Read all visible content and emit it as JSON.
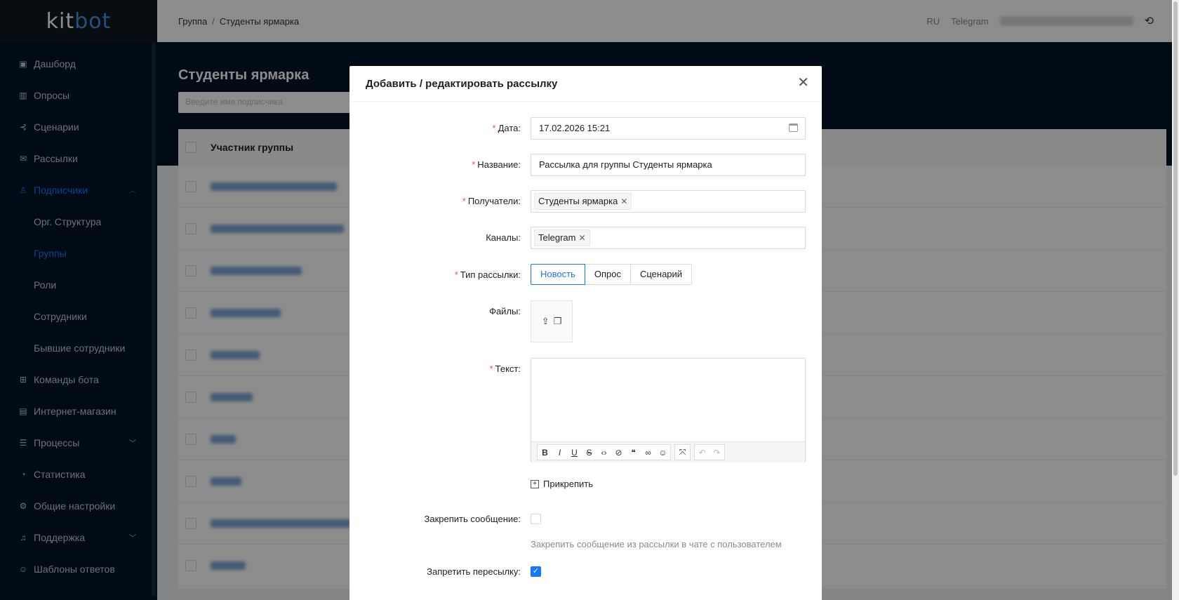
{
  "logo": {
    "prefix": "kit",
    "suffix": "bot"
  },
  "header": {
    "breadcrumb": [
      "Группа",
      "Студенты ярмарка"
    ],
    "lang": "RU",
    "channel": "Telegram"
  },
  "sidebar": {
    "items": [
      {
        "label": "Дашборд",
        "icon": "dashboard-icon"
      },
      {
        "label": "Опросы",
        "icon": "chart-icon"
      },
      {
        "label": "Сценарии",
        "icon": "scenario-icon"
      },
      {
        "label": "Рассылки",
        "icon": "mail-icon"
      },
      {
        "label": "Подписчики",
        "icon": "users-icon",
        "active": true
      },
      {
        "label": "Орг. Структура",
        "sub": true
      },
      {
        "label": "Группы",
        "sub": true,
        "active": true
      },
      {
        "label": "Роли",
        "sub": true
      },
      {
        "label": "Сотрудники",
        "sub": true
      },
      {
        "label": "Бывшие сотрудники",
        "sub": true
      },
      {
        "label": "Команды бота",
        "icon": "grid-icon"
      },
      {
        "label": "Интернет-магазин",
        "icon": "shop-icon"
      },
      {
        "label": "Процессы",
        "icon": "list-icon"
      },
      {
        "label": "Статистика",
        "icon": "pie-icon"
      },
      {
        "label": "Общие настройки",
        "icon": "gear-icon"
      },
      {
        "label": "Поддержка",
        "icon": "headset-icon"
      },
      {
        "label": "Шаблоны ответов",
        "icon": "template-icon"
      }
    ]
  },
  "page": {
    "title": "Студенты ярмарка",
    "search_placeholder": "Введите имя подписчика",
    "table_header": "Участник группы"
  },
  "modal": {
    "title": "Добавить / редактировать рассылку",
    "date_label": "Дата",
    "date_value": "17.02.2026 15:21",
    "name_label": "Название",
    "name_value": "Рассылка для группы Студенты ярмарка",
    "recipients_label": "Получатели",
    "recipients_tag": "Студенты ярмарка",
    "channels_label": "Каналы",
    "channels_tag": "Telegram",
    "type_label": "Тип рассылки",
    "type_options": [
      "Новость",
      "Опрос",
      "Сценарий"
    ],
    "type_selected": "Новость",
    "files_label": "Файлы",
    "text_label": "Текст",
    "attach_label": "Прикрепить",
    "pin_label": "Закрепить сообщение",
    "pin_checked": false,
    "pin_hint": "Закрепить сообщение из рассылки в чате с пользователем",
    "forward_label": "Запретить пересылку",
    "forward_checked": true,
    "accent": "#1677ff"
  },
  "toolbar": {
    "bold": "B",
    "italic": "I",
    "underline": "U",
    "strike": "S"
  }
}
